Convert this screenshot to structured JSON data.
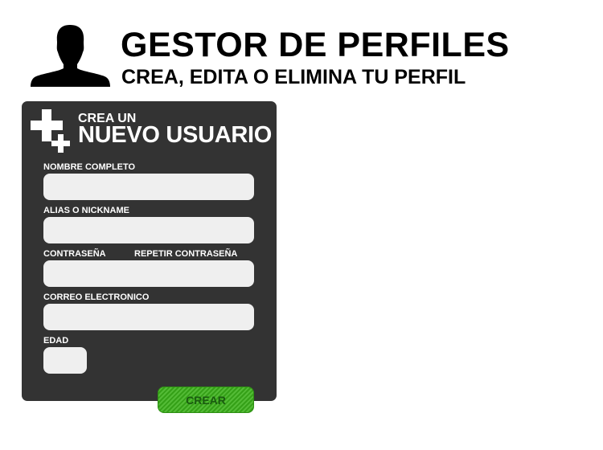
{
  "header": {
    "icon": "user-silhouette-icon",
    "title": "GESTOR DE PERFILES",
    "subtitle": "CREA, EDITA O ELIMINA TU PERFIL"
  },
  "panel": {
    "icon": "add-user-plus-icon",
    "pretitle": "CREA UN",
    "title": "NUEVO USUARIO",
    "background_color": "#333333"
  },
  "form": {
    "full_name": {
      "label": "NOMBRE COMPLETO",
      "value": "",
      "placeholder": ""
    },
    "alias": {
      "label": "ALIAS O NICKNAME",
      "value": "",
      "placeholder": ""
    },
    "password": {
      "label": "CONTRASEÑA",
      "value": "",
      "placeholder": ""
    },
    "repeat_password": {
      "label": "REPETIR CONTRASEÑA",
      "value": "",
      "placeholder": ""
    },
    "email": {
      "label": "CORREO ELECTRONICO",
      "value": "",
      "placeholder": ""
    },
    "age": {
      "label": "EDAD",
      "value": "",
      "placeholder": ""
    },
    "submit_label": "CREAR",
    "submit_color": "#3bb21a"
  }
}
